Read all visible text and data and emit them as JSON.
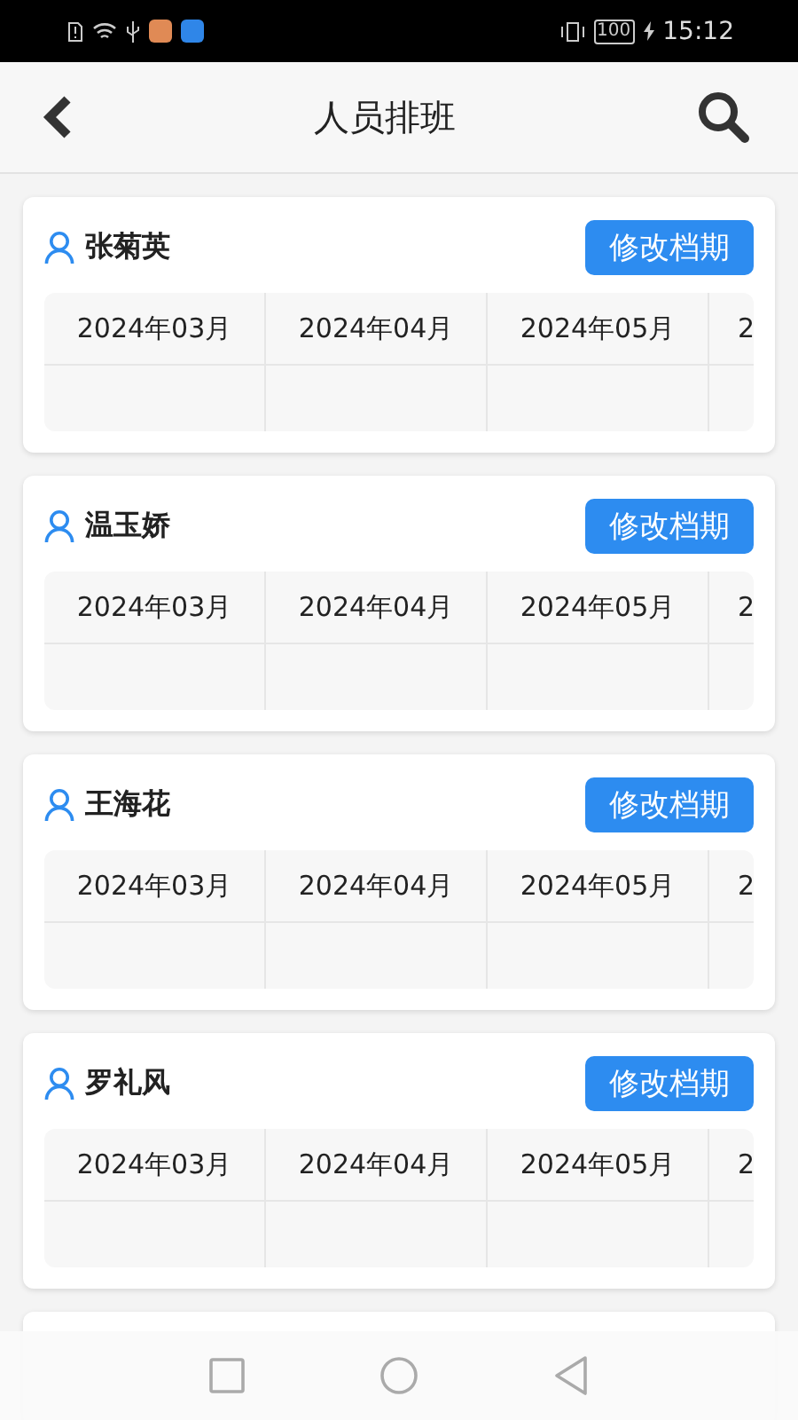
{
  "status_bar": {
    "battery": "100",
    "time": "15:12"
  },
  "header": {
    "title": "人员排班"
  },
  "people": [
    {
      "name": "张菊英",
      "button": "修改档期",
      "months": [
        "2024年03月",
        "2024年04月",
        "2024年05月",
        "2"
      ]
    },
    {
      "name": "温玉娇",
      "button": "修改档期",
      "months": [
        "2024年03月",
        "2024年04月",
        "2024年05月",
        "2"
      ]
    },
    {
      "name": "王海花",
      "button": "修改档期",
      "months": [
        "2024年03月",
        "2024年04月",
        "2024年05月",
        "2"
      ]
    },
    {
      "name": "罗礼风",
      "button": "修改档期",
      "months": [
        "2024年03月",
        "2024年04月",
        "2024年05月",
        "2"
      ]
    }
  ]
}
